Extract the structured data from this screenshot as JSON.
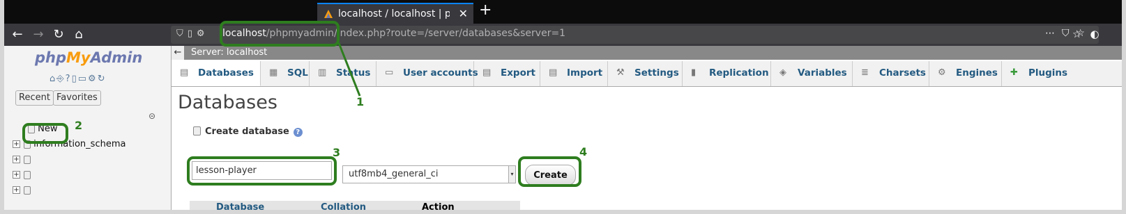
{
  "browser": {
    "tab_title": "localhost / localhost | php",
    "close_glyph": "✕",
    "new_tab_glyph": "+",
    "url_host": "localhost",
    "url_path": "/phpmyadmin/index.php?route=/server/databases&server=1"
  },
  "pma": {
    "logo_php": "php",
    "logo_my": "My",
    "logo_admin": "Admin",
    "recent_label": "Recent",
    "favorites_label": "Favorites",
    "tree": {
      "new_label": "New",
      "items": [
        "information_schema",
        "",
        "",
        ""
      ]
    },
    "breadcrumb": "Server: localhost",
    "tabs": [
      "Databases",
      "SQL",
      "Status",
      "User accounts",
      "Export",
      "Import",
      "Settings",
      "Replication",
      "Variables",
      "Charsets",
      "Engines",
      "Plugins"
    ],
    "page_title": "Databases",
    "create_header": "Create database",
    "db_name_value": "lesson-player",
    "collation_value": "utf8mb4_general_ci",
    "create_button": "Create",
    "table_headers": [
      "Database",
      "Collation",
      "Action"
    ]
  },
  "annotations": {
    "labels": [
      "1",
      "2",
      "3",
      "4"
    ],
    "color": "#2e7d1f"
  }
}
